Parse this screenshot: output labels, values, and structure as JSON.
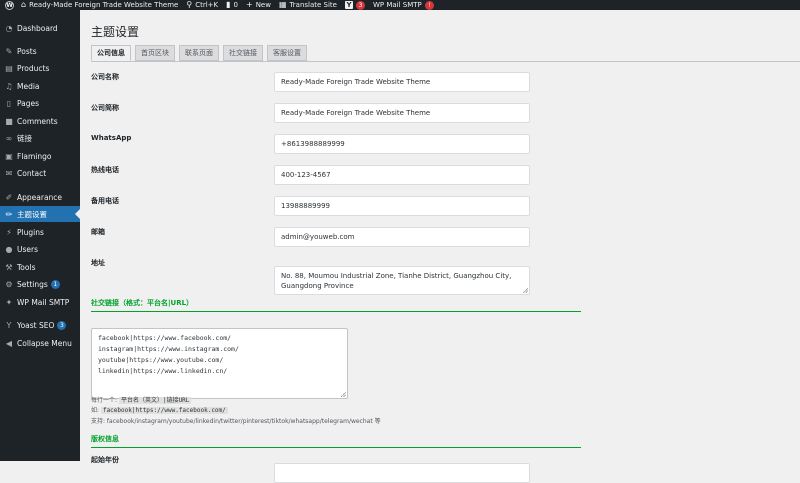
{
  "admin_bar": {
    "site_name": "Ready-Made Foreign Trade Website Theme",
    "shortcut": "Ctrl+K",
    "comments_count": "0",
    "new_label": "New",
    "translate_label": "Translate Site",
    "yoast_badge": "3",
    "smtp_label": "WP Mail SMTP",
    "smtp_badge": "!"
  },
  "sidebar": {
    "items": [
      {
        "label": "Dashboard",
        "icon": "dashboard-icon"
      },
      {
        "label": "Posts",
        "icon": "pin-icon"
      },
      {
        "label": "Products",
        "icon": "products-icon"
      },
      {
        "label": "Media",
        "icon": "media-icon"
      },
      {
        "label": "Pages",
        "icon": "pages-icon"
      },
      {
        "label": "Comments",
        "icon": "comment-icon"
      },
      {
        "label": "链接",
        "icon": "link-icon"
      },
      {
        "label": "Flamingo",
        "icon": "flamingo-icon"
      },
      {
        "label": "Contact",
        "icon": "mail-icon"
      },
      {
        "label": "Appearance",
        "icon": "brush-icon"
      },
      {
        "label": "主题设置",
        "icon": "pencil-icon"
      },
      {
        "label": "Plugins",
        "icon": "plugin-icon"
      },
      {
        "label": "Users",
        "icon": "user-icon"
      },
      {
        "label": "Tools",
        "icon": "wrench-icon"
      },
      {
        "label": "Settings",
        "icon": "settings-icon",
        "badge": "1"
      },
      {
        "label": "WP Mail SMTP",
        "icon": "smtp-icon"
      },
      {
        "label": "Yoast SEO",
        "icon": "yoast-icon",
        "badge": "3"
      },
      {
        "label": "Collapse Menu",
        "icon": "collapse-icon"
      }
    ]
  },
  "page": {
    "title": "主题设置",
    "tabs": [
      "公司信息",
      "首页区块",
      "联系页面",
      "社交链接",
      "客服设置"
    ],
    "active_tab": "公司信息"
  },
  "fields": {
    "company_name": {
      "label": "公司名称",
      "value": "Ready-Made Foreign Trade Website Theme"
    },
    "company_short": {
      "label": "公司简称",
      "value": "Ready-Made Foreign Trade Website Theme"
    },
    "whatsapp": {
      "label": "WhatsApp",
      "value": "+8613988889999"
    },
    "hotline": {
      "label": "热线电话",
      "value": "400-123-4567"
    },
    "backup_phone": {
      "label": "备用电话",
      "value": "13988889999"
    },
    "email": {
      "label": "邮箱",
      "value": "admin@youweb.com"
    },
    "address": {
      "label": "地址",
      "line1": "No. 88, Moumou Industrial Zone, Tianhe District, Guangzhou City,",
      "line2": "Guangdong Province"
    }
  },
  "social": {
    "section_title": "社交链接（格式：平台名|URL）",
    "lines": [
      "facebook|https://www.facebook.com/",
      "instagram|https://www.instagram.com/",
      "youtube|https://www.youtube.com/",
      "linkedin|https://www.linkedin.cn/"
    ],
    "help_prefix": "每行一个:",
    "help_format": "平台名（英文）|链接URL",
    "example_prefix": "如:",
    "example_code": "facebook|https://www.facebook.com/",
    "support_text": "支持: facebook/instagram/youtube/linkedin/twitter/pinterest/tiktok/whatsapp/telegram/wechat 等"
  },
  "copyright": {
    "section_title": "版权信息",
    "year_label": "起始年份"
  }
}
